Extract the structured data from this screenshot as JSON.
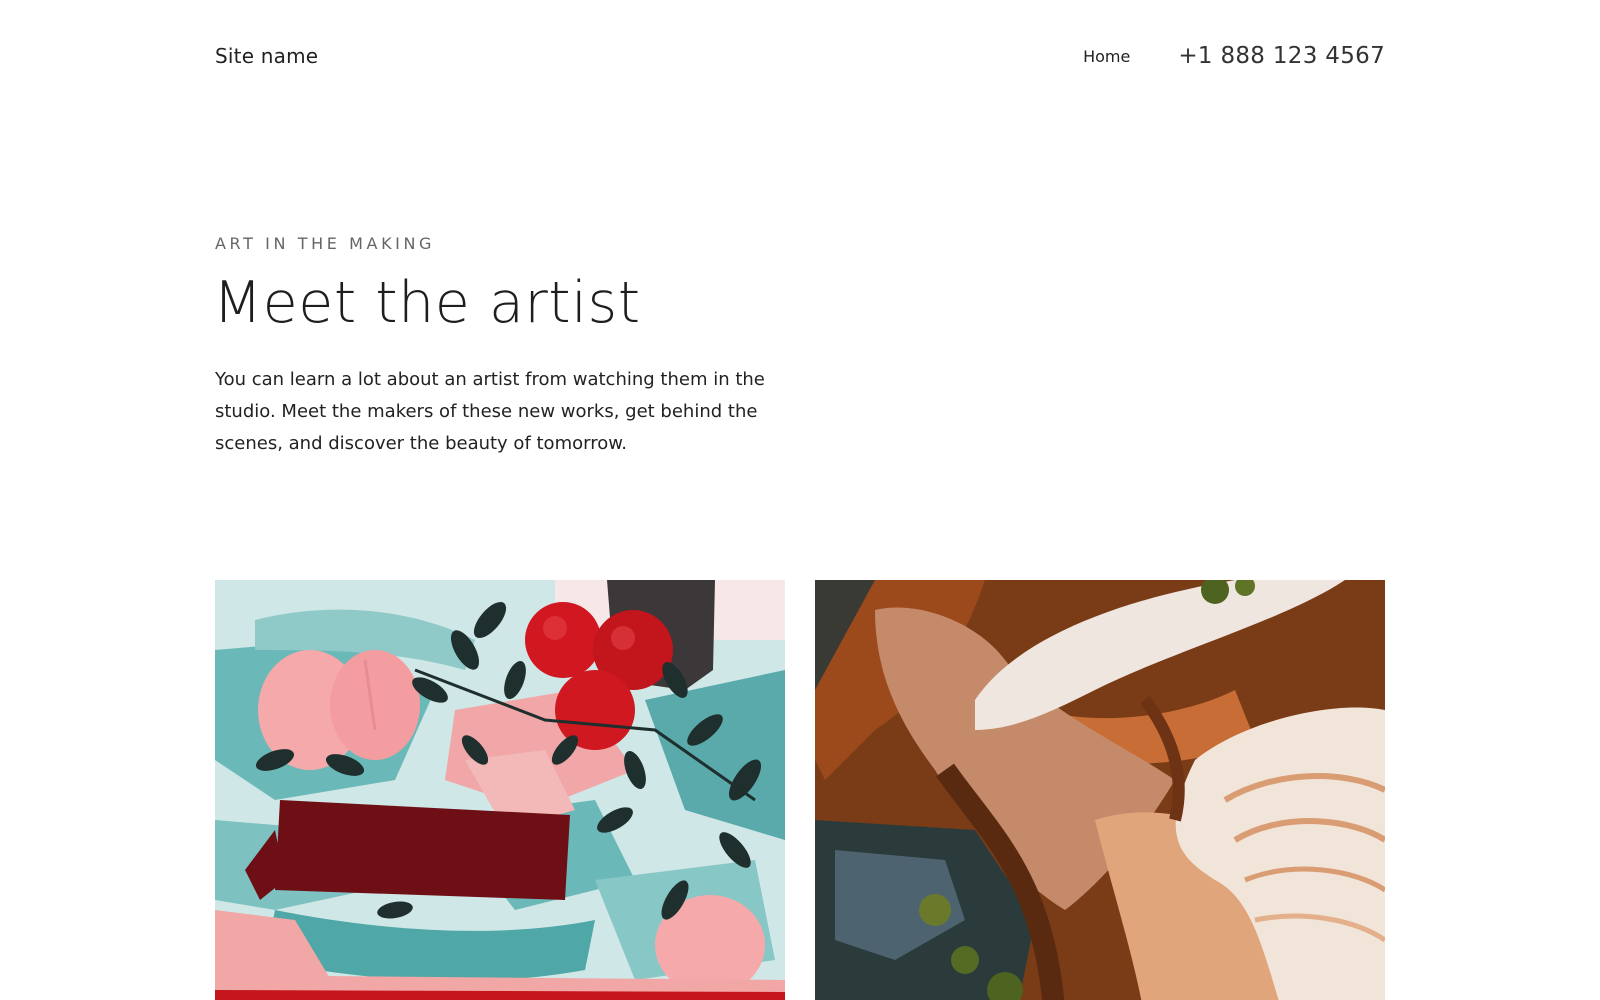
{
  "header": {
    "site_name": "Site name",
    "nav": [
      {
        "label": "Home"
      }
    ],
    "phone": "+1 888 123 4567"
  },
  "hero": {
    "eyebrow": "ART IN THE MAKING",
    "title": "Meet the artist",
    "body": "You can learn a lot about an artist from watching them in the studio. Meet the makers of these new works, get behind the scenes, and discover the beauty of tomorrow."
  },
  "gallery": [
    {
      "name": "floral-painting"
    },
    {
      "name": "aerial-landscape"
    }
  ],
  "colors": {
    "background": "#ffffff",
    "text": "#1e1e1e",
    "muted": "#666666",
    "teal": "#5fb3b3",
    "pink": "#f4a9a8",
    "red": "#c4161c",
    "sand": "#e3a981",
    "earth": "#7a3b17"
  }
}
